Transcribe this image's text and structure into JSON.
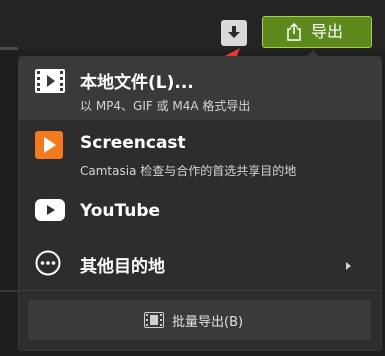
{
  "toolbar": {
    "download_icon": "download-arrow-icon",
    "export_label": "导出",
    "export_icon": "share-icon",
    "accent_color": "#5d8a1e",
    "annotation_color": "#e53935"
  },
  "menu": {
    "items": [
      {
        "title": "本地文件(L)...",
        "subtitle": "以 MP4、GIF 或 M4A 格式导出",
        "icon": "film-icon"
      },
      {
        "title": "Screencast",
        "subtitle": "Camtasia 检查与合作的首选共享目的地",
        "icon": "screencast-icon"
      },
      {
        "title": "YouTube",
        "icon": "youtube-icon"
      },
      {
        "title": "其他目的地",
        "icon": "more-dots-icon",
        "has_submenu": true
      }
    ],
    "batch_export_label": "批量导出(B)",
    "batch_export_icon": "film-icon"
  }
}
